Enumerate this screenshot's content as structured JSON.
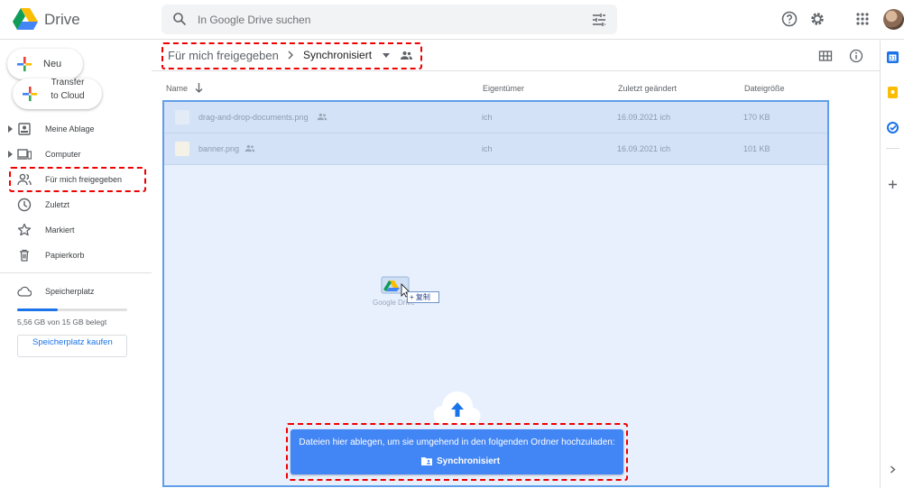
{
  "header": {
    "app_title": "Drive",
    "search_placeholder": "In Google Drive suchen",
    "icons": [
      "google-drive-logo",
      "search-icon",
      "search-options-icon",
      "help-icon",
      "settings-icon",
      "apps-icon",
      "avatar"
    ]
  },
  "sidebar": {
    "new_label": "Neu",
    "transfer_label": "Transfer to Cloud",
    "items": [
      {
        "label": "Meine Ablage",
        "icon": "my-drive-icon",
        "expandable": true
      },
      {
        "label": "Computer",
        "icon": "computer-icon",
        "expandable": true
      },
      {
        "label": "Für mich freigegeben",
        "icon": "shared-with-me-icon",
        "expandable": false,
        "highlighted": true
      },
      {
        "label": "Zuletzt",
        "icon": "recent-icon",
        "expandable": false
      },
      {
        "label": "Markiert",
        "icon": "star-icon",
        "expandable": false
      },
      {
        "label": "Papierkorb",
        "icon": "trash-icon",
        "expandable": false
      }
    ],
    "storage": {
      "label": "Speicherplatz",
      "usage_text": "5,56 GB von 15 GB belegt",
      "used_fraction": 0.37,
      "buy_label": "Speicherplatz kaufen"
    }
  },
  "breadcrumb": {
    "parent": "Für mich freigegeben",
    "current": "Synchronisiert"
  },
  "columns": {
    "name": "Name",
    "owner": "Eigentümer",
    "modified": "Zuletzt geändert",
    "size": "Dateigröße"
  },
  "files": [
    {
      "name": "drag-and-drop-documents.png",
      "owner": "ich",
      "modified": "16.09.2021 ich",
      "size": "170 KB"
    },
    {
      "name": "banner.png",
      "owner": "ich",
      "modified": "16.09.2021 ich",
      "size": "101 KB"
    }
  ],
  "drag": {
    "badge": "+ 复制",
    "label": "Google Drive"
  },
  "upload_banner": {
    "line1": "Dateien hier ablegen, um sie umgehend in den folgenden Ordner hochzuladen:",
    "folder": "Synchronisiert"
  },
  "colors": {
    "accent": "#1a73e8",
    "banner": "#4285f4",
    "highlight": "#ee0000",
    "dropzone": "#e8f0fe"
  }
}
